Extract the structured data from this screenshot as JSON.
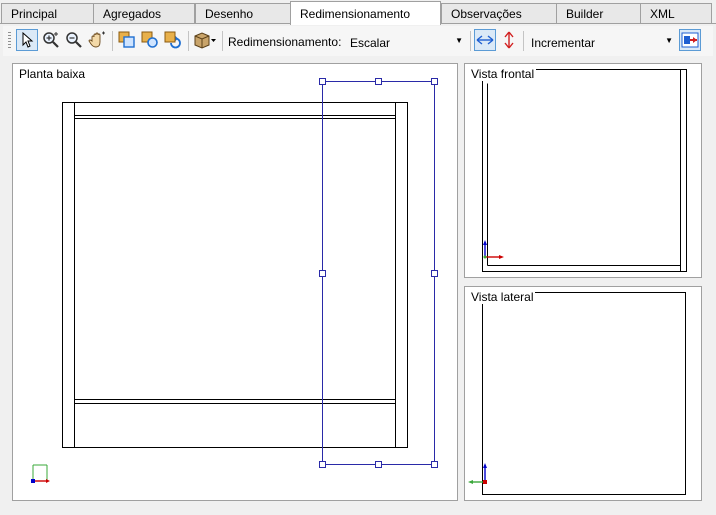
{
  "tabs": [
    {
      "label": "Principal",
      "active": false
    },
    {
      "label": "Agregados",
      "active": false
    },
    {
      "label": "Desenho",
      "active": false
    },
    {
      "label": "Redimensionamento",
      "active": true
    },
    {
      "label": "Observações",
      "active": false
    },
    {
      "label": "Builder",
      "active": false
    },
    {
      "label": "XML",
      "active": false
    }
  ],
  "toolbar": {
    "resize_label": "Redimensionamento:",
    "mode_value": "Escalar",
    "increment_value": "Incrementar",
    "icons": [
      "select-icon",
      "zoom-in-icon",
      "zoom-out-icon",
      "pan-icon",
      "move-icon",
      "rotate-icon",
      "rotate-alt-icon",
      "view-3d-icon",
      "horizontal-resize-icon",
      "vertical-resize-icon",
      "apply-icon"
    ]
  },
  "views": {
    "plan": {
      "title": "Planta baixa"
    },
    "front": {
      "title": "Vista frontal"
    },
    "side": {
      "title": "Vista lateral"
    }
  },
  "colors": {
    "selection": "#2a2aa8",
    "active_tab": "#ffffff",
    "axis_x": "#cc0000",
    "axis_y": "#0000cc",
    "axis_z": "#3aa83a"
  }
}
